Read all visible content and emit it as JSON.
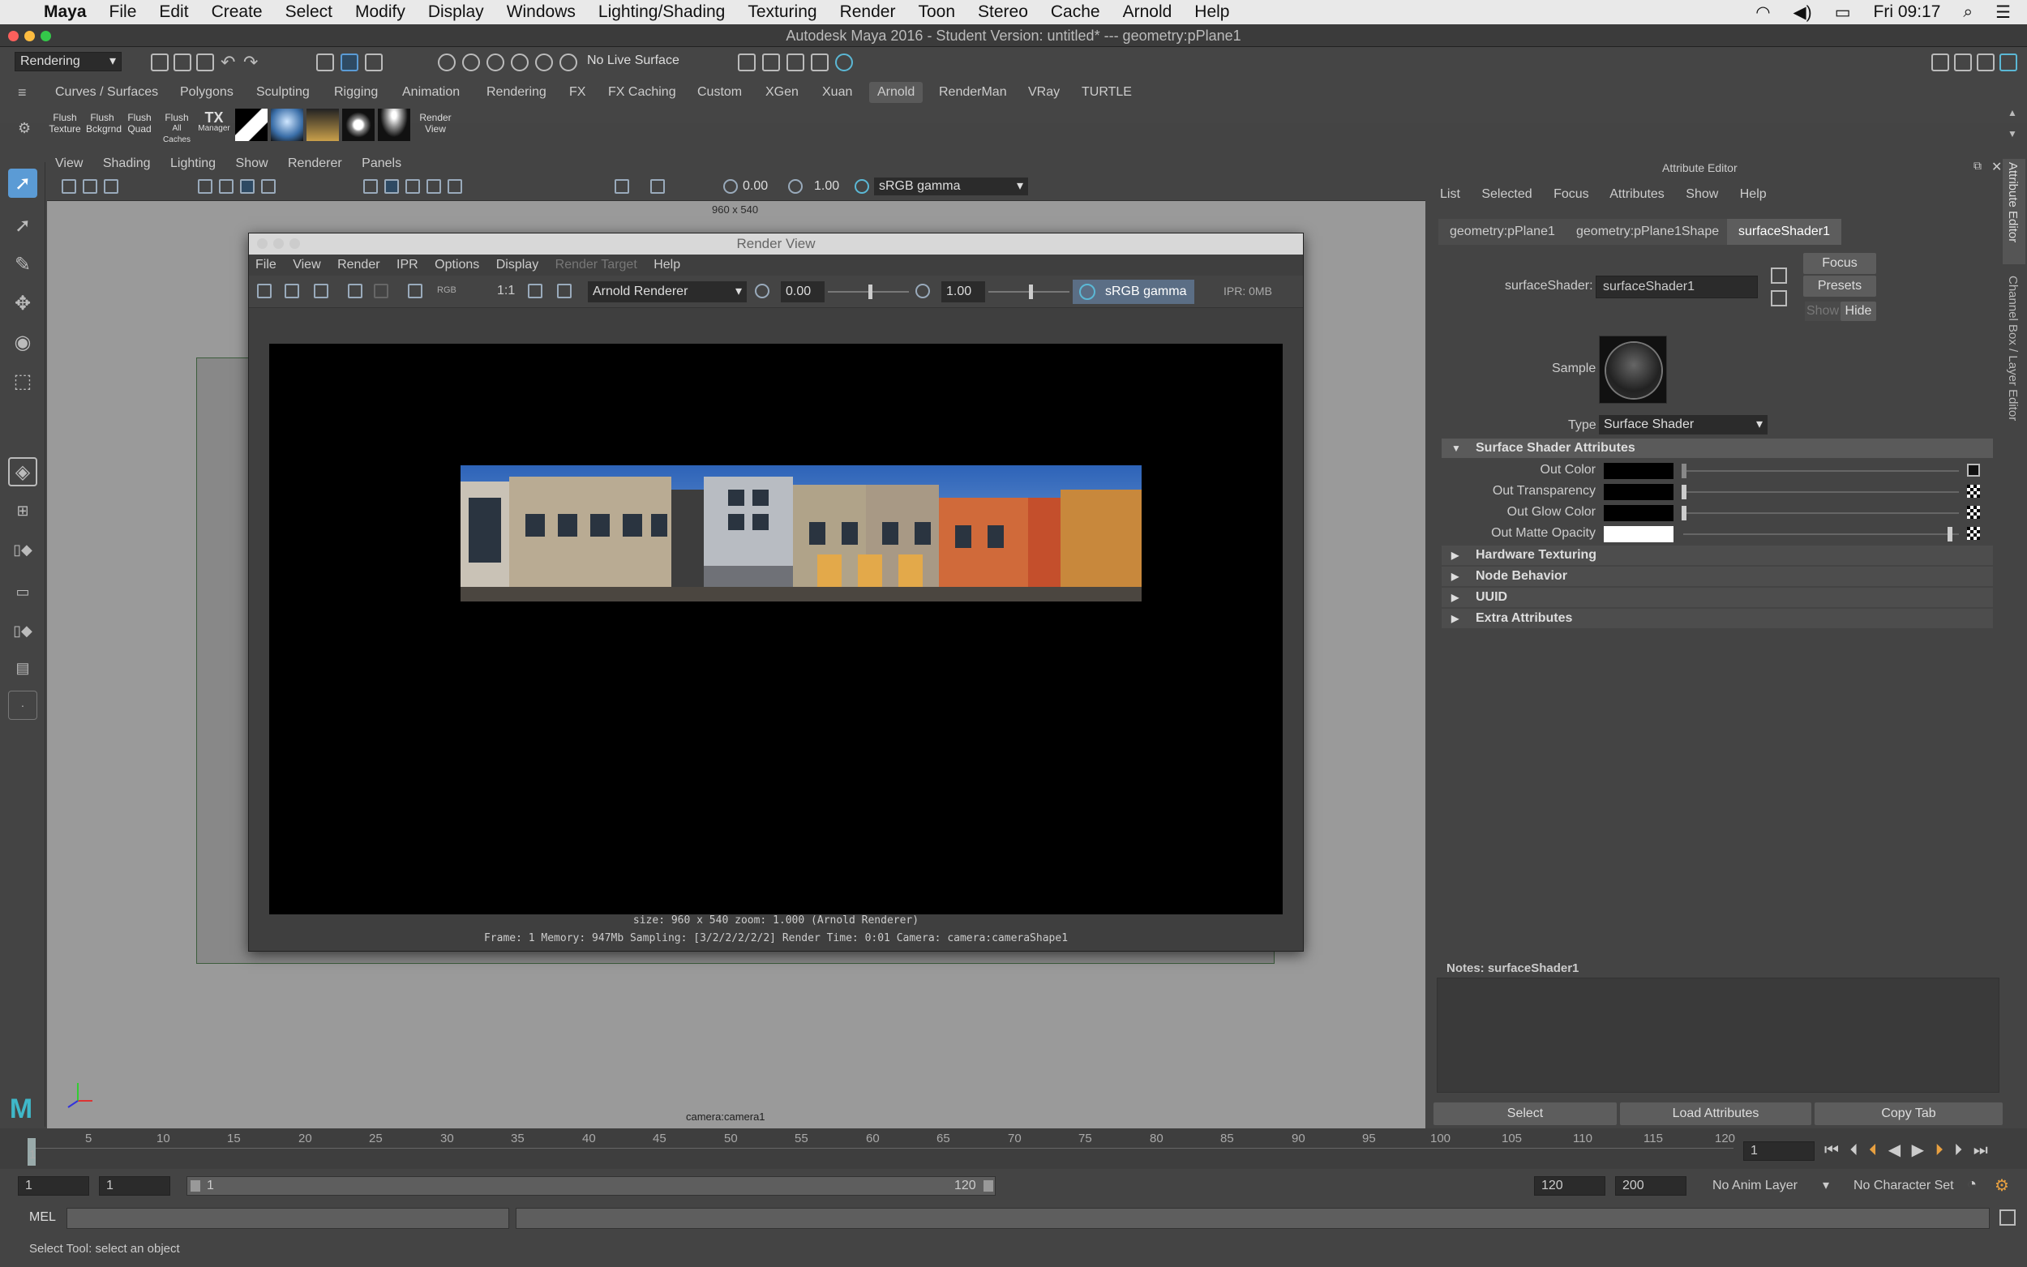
{
  "macmenu": {
    "apple": "",
    "app": "Maya",
    "items": [
      "File",
      "Edit",
      "Create",
      "Select",
      "Modify",
      "Display",
      "Windows",
      "Lighting/Shading",
      "Texturing",
      "Render",
      "Toon",
      "Stereo",
      "Cache",
      "Arnold",
      "Help"
    ],
    "clock": "Fri 09:17"
  },
  "window": {
    "title": "Autodesk Maya 2016 - Student Version: untitled*   ---   geometry:pPlane1"
  },
  "statusline": {
    "menuset": "Rendering",
    "live_surface": "No Live Surface"
  },
  "shelf": {
    "tabs": [
      "Curves / Surfaces",
      "Polygons",
      "Sculpting",
      "Rigging",
      "Animation",
      "Rendering",
      "FX",
      "FX Caching",
      "Custom",
      "XGen",
      "Xuan",
      "Arnold",
      "RenderMan",
      "VRay",
      "TURTLE"
    ],
    "active_tab": "Arnold",
    "buttons": [
      {
        "l1": "Flush",
        "l2": "Texture"
      },
      {
        "l1": "Flush",
        "l2": "Bckgrnd"
      },
      {
        "l1": "Flush",
        "l2": "Quad"
      },
      {
        "l1": "Flush",
        "l2": "All Caches"
      },
      {
        "l1": "TX",
        "l2": "Manager"
      }
    ],
    "render_view": {
      "l1": "Render",
      "l2": "View"
    }
  },
  "viewport": {
    "menu": [
      "View",
      "Shading",
      "Lighting",
      "Show",
      "Renderer",
      "Panels"
    ],
    "exposure": "0.00",
    "gamma": "1.00",
    "colorspace": "sRGB gamma",
    "resolution": "960 x 540",
    "camera": "camera:camera1"
  },
  "render_view": {
    "title": "Render View",
    "menu": [
      "File",
      "View",
      "Render",
      "IPR",
      "Options",
      "Display",
      "Render Target",
      "Help"
    ],
    "ratio": "1:1",
    "rgb": "RGB",
    "renderer": "Arnold Renderer",
    "exposure": "0.00",
    "gamma": "1.00",
    "colorspace": "sRGB gamma",
    "ipr": "IPR: 0MB",
    "info1": "size: 960 x 540 zoom: 1.000    (Arnold Renderer)",
    "info2": "Frame: 1    Memory: 947Mb    Sampling: [3/2/2/2/2/2]    Render Time: 0:01    Camera: camera:cameraShape1"
  },
  "attribute_editor": {
    "title": "Attribute Editor",
    "menu": [
      "List",
      "Selected",
      "Focus",
      "Attributes",
      "Show",
      "Help"
    ],
    "tabs": [
      "geometry:pPlane1",
      "geometry:pPlane1Shape",
      "surfaceShader1"
    ],
    "active_tab": "surfaceShader1",
    "shader_label": "surfaceShader:",
    "shader_name": "surfaceShader1",
    "focus": "Focus",
    "presets": "Presets",
    "show": "Show",
    "hide": "Hide",
    "sample_label": "Sample",
    "type_label": "Type",
    "type_value": "Surface Shader",
    "section_open": "Surface Shader Attributes",
    "attrs": [
      {
        "label": "Out Color",
        "swatch": "#000000",
        "slider": 0.0
      },
      {
        "label": "Out Transparency",
        "swatch": "#000000",
        "slider": 0.0
      },
      {
        "label": "Out Glow Color",
        "swatch": "#000000",
        "slider": 0.0
      },
      {
        "label": "Out Matte Opacity",
        "swatch": "#ffffff",
        "slider": 1.0
      }
    ],
    "sections_closed": [
      "Hardware Texturing",
      "Node Behavior",
      "UUID",
      "Extra Attributes"
    ],
    "notes_label": "Notes:  surfaceShader1",
    "bottom_buttons": [
      "Select",
      "Load Attributes",
      "Copy Tab"
    ],
    "side_tabs": [
      "Attribute Editor",
      "Channel Box / Layer Editor"
    ]
  },
  "timeline": {
    "ticks": [
      "1",
      "5",
      "10",
      "15",
      "20",
      "25",
      "30",
      "35",
      "40",
      "45",
      "50",
      "55",
      "60",
      "65",
      "70",
      "75",
      "80",
      "85",
      "90",
      "95",
      "100",
      "105",
      "110",
      "115",
      "120"
    ],
    "current": "1"
  },
  "range": {
    "start": "1",
    "start2": "1",
    "slider_start": "1",
    "slider_end": "120",
    "end": "120",
    "end2": "200",
    "anim_layer": "No Anim Layer",
    "char_set": "No Character Set"
  },
  "cmdline": {
    "lang": "MEL"
  },
  "helpline": "Select Tool: select an object",
  "colors": {
    "accent": "#5b9bd5",
    "panel": "#444444",
    "dark": "#2b2b2b"
  }
}
